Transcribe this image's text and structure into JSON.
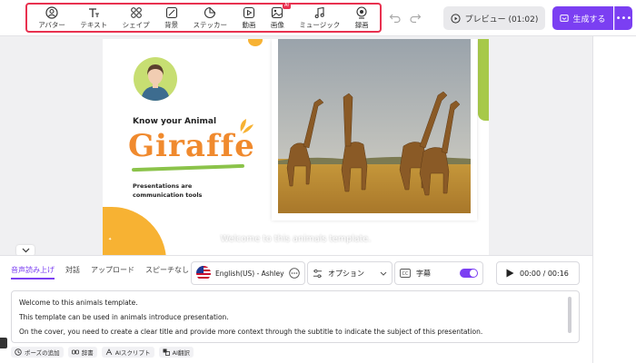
{
  "toolbar": {
    "tools": [
      {
        "label": "アバター",
        "icon": "avatar-icon"
      },
      {
        "label": "テキスト",
        "icon": "text-icon"
      },
      {
        "label": "シェイプ",
        "icon": "shape-icon"
      },
      {
        "label": "背景",
        "icon": "background-icon"
      },
      {
        "label": "ステッカー",
        "icon": "sticker-icon"
      },
      {
        "label": "動画",
        "icon": "video-icon"
      },
      {
        "label": "画像",
        "icon": "image-icon",
        "badge": "AI"
      },
      {
        "label": "ミュージック",
        "icon": "music-icon"
      },
      {
        "label": "録画",
        "icon": "record-icon"
      }
    ],
    "preview_label": "プレビュー (01:02)",
    "generate_label": "生成する",
    "more_label": "•••",
    "highlight_color": "#e8314f",
    "accent_color": "#7b3ff2"
  },
  "slide": {
    "heading": "Know your Animal",
    "title": "Giraffe",
    "subtitle": "Presentations are communication tools",
    "title_color": "#f08a2e",
    "accent_green": "#a7c94a",
    "accent_orange": "#f7b233"
  },
  "caption": "Welcome to this animals template.",
  "panel": {
    "tabs": [
      "音声読み上げ",
      "対話",
      "アップロード",
      "スピーチなし"
    ],
    "active_tab": 0,
    "voice": "English(US) - Ashley",
    "options_label": "オプション",
    "subtitles_label": "字幕",
    "subtitles_on": true,
    "time": "00:00 / 00:16",
    "script_lines": [
      "Welcome to this animals template.",
      "This template can be used in animals introduce presentation.",
      "On the cover, you need to create a clear title and provide more context through the subtitle to indicate the subject of this presentation."
    ],
    "chips": [
      {
        "label": "ポーズの追加",
        "icon": "clock-icon"
      },
      {
        "label": "辞書",
        "icon": "dictionary-icon"
      },
      {
        "label": "AIスクリプト",
        "icon": "ai-script-icon"
      },
      {
        "label": "AI翻訳",
        "icon": "ai-translate-icon"
      }
    ]
  }
}
